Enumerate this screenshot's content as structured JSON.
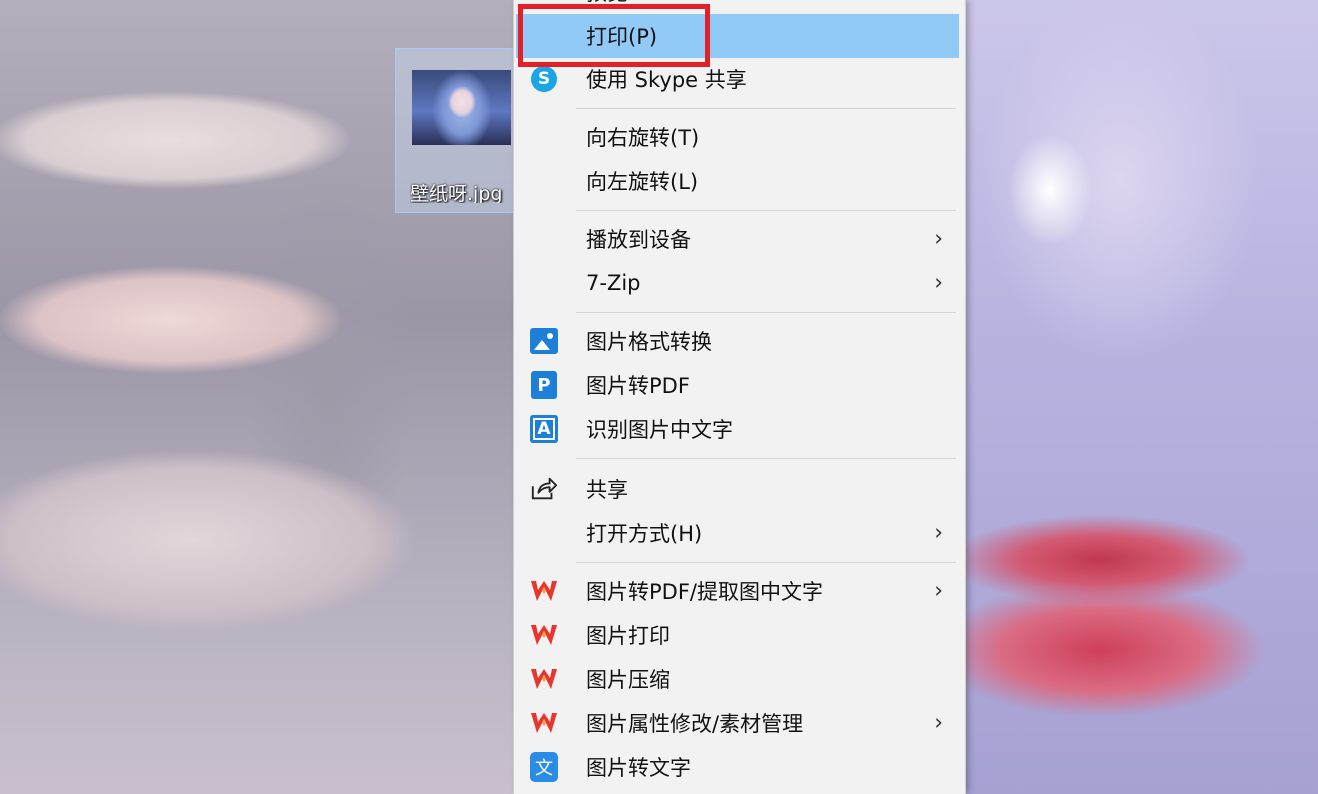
{
  "desktop": {
    "file_name": "壁纸呀.jpg"
  },
  "context_menu": {
    "partial_top_label": "预览",
    "items": [
      {
        "label": "打印(P)",
        "icon": "",
        "submenu": false,
        "highlighted": true
      },
      {
        "label": "使用 Skype 共享",
        "icon": "skype-icon",
        "submenu": false
      },
      {
        "label": "向右旋转(T)",
        "icon": "",
        "submenu": false
      },
      {
        "label": "向左旋转(L)",
        "icon": "",
        "submenu": false
      },
      {
        "label": "播放到设备",
        "icon": "",
        "submenu": true
      },
      {
        "label": "7-Zip",
        "icon": "",
        "submenu": true
      },
      {
        "label": "图片格式转换",
        "icon": "image-convert-icon",
        "submenu": false
      },
      {
        "label": "图片转PDF",
        "icon": "pdf-p-icon",
        "submenu": false
      },
      {
        "label": "识别图片中文字",
        "icon": "ocr-icon",
        "submenu": false
      },
      {
        "label": "共享",
        "icon": "share-icon",
        "submenu": false
      },
      {
        "label": "打开方式(H)",
        "icon": "",
        "submenu": true
      },
      {
        "label": "图片转PDF/提取图中文字",
        "icon": "wps-icon",
        "submenu": true
      },
      {
        "label": "图片打印",
        "icon": "wps-icon",
        "submenu": false
      },
      {
        "label": "图片压缩",
        "icon": "wps-icon",
        "submenu": false
      },
      {
        "label": "图片属性修改/素材管理",
        "icon": "wps-icon",
        "submenu": true
      },
      {
        "label": "图片转文字",
        "icon": "image-to-text-icon",
        "submenu": false
      }
    ],
    "arrow_glyph": "›",
    "skype_glyph": "S",
    "pdf_glyph": "P",
    "ocr_glyph": "A",
    "wenzi_glyph": "文"
  },
  "colors": {
    "menu_background": "#f2f2f2",
    "hover_background": "#91c9f7",
    "annotation_red": "#e3202a",
    "wps_red": "#e8362c"
  }
}
